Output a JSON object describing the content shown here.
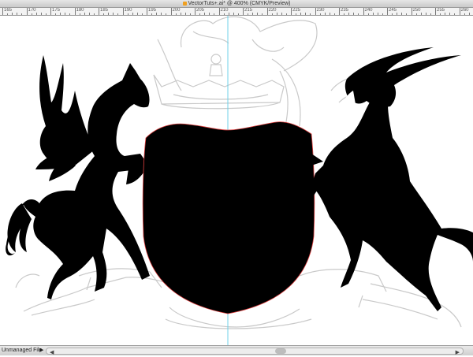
{
  "window": {
    "title": "VectorTuts+.ai* @ 400% (CMYK/Preview)"
  },
  "ruler": {
    "labels": [
      "165",
      "170",
      "175",
      "180",
      "185",
      "190",
      "195",
      "200",
      "205",
      "210",
      "215",
      "220",
      "225",
      "230",
      "235",
      "240",
      "245",
      "250",
      "255",
      "260"
    ]
  },
  "status": {
    "text": "Unmanaged File",
    "arrow": "▶"
  },
  "scroll": {
    "left_arrow": "◀",
    "right_arrow": "▶"
  },
  "colors": {
    "guide": "#6fd0e8",
    "sketch": "#c8c8c8",
    "fill": "#000000",
    "path_outline": "#e04040"
  }
}
